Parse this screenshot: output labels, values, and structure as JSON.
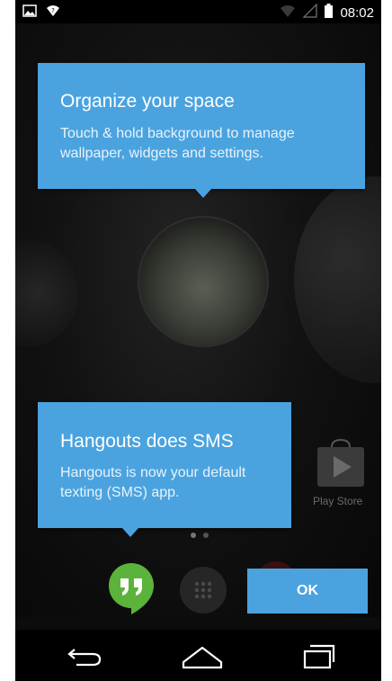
{
  "status_bar": {
    "time": "08:02",
    "icons": [
      "image-notification-icon",
      "wifi-notification-icon",
      "wifi-signal-icon",
      "cell-signal-icon",
      "battery-icon"
    ]
  },
  "coach_marks": [
    {
      "title": "Organize your space",
      "body": "Touch & hold background to manage wallpaper, widgets and settings."
    },
    {
      "title": "Hangouts does SMS",
      "body": "Hangouts is now your default texting (SMS) app."
    }
  ],
  "ok_button": {
    "label": "OK"
  },
  "dock": {
    "hangouts_icon": "hangouts-icon",
    "apps_icon": "all-apps-icon",
    "play_store_label": "Play Store"
  },
  "colors": {
    "accent": "#4aa3df",
    "hangouts_green": "#5bb33c",
    "background": "#0c0c0c"
  },
  "nav_bar": {
    "icons": [
      "back-icon",
      "home-icon",
      "recents-icon"
    ]
  }
}
